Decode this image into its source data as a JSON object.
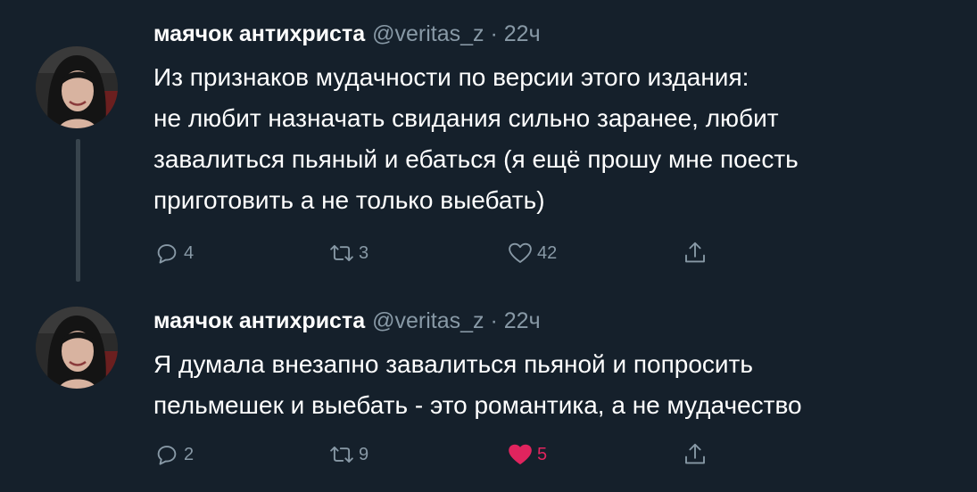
{
  "tweets": [
    {
      "author_name": "маячок антихриста",
      "handle": "@veritas_z",
      "separator": "·",
      "time": "22ч",
      "lines": [
        "Из признаков мудачности по версии этого издания:",
        "не любит назначать  свидания сильно заранее, любит",
        "завалиться пьяный и ебаться (я ещё прошу мне поесть",
        "приготовить а не только выебать)"
      ],
      "replies": "4",
      "retweets": "3",
      "likes": "42",
      "liked": false
    },
    {
      "author_name": "маячок антихриста",
      "handle": "@veritas_z",
      "separator": "·",
      "time": "22ч",
      "lines": [
        "Я думала внезапно завалиться пьяной и попросить",
        "пельмешек и выебать - это романтика, а не мудачество"
      ],
      "replies": "2",
      "retweets": "9",
      "likes": "5",
      "liked": true
    }
  ],
  "icons": {
    "reply": "reply-icon",
    "retweet": "retweet-icon",
    "like": "heart-icon",
    "share": "share-icon"
  },
  "colors": {
    "background": "#15202b",
    "secondary_text": "#8899a6",
    "like_active": "#e0245e",
    "thread_line": "#38444d"
  }
}
